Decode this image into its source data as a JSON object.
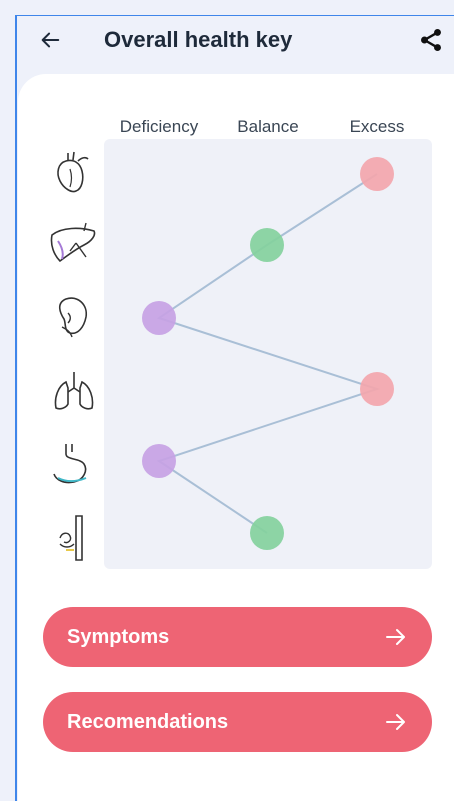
{
  "header": {
    "title": "Overall health key",
    "back_icon": "arrow-left-icon",
    "share_icon": "share-icon"
  },
  "chart_data": {
    "type": "scatter",
    "columns": [
      "Deficiency",
      "Balance",
      "Excess"
    ],
    "rows": [
      {
        "organ": "heart",
        "icon": "heart-icon",
        "level": "Excess",
        "color": "#f3a6ad"
      },
      {
        "organ": "liver",
        "icon": "liver-icon",
        "level": "Balance",
        "color": "#84d19d"
      },
      {
        "organ": "kidney",
        "icon": "kidney-icon",
        "level": "Deficiency",
        "color": "#c7a2e4"
      },
      {
        "organ": "lungs",
        "icon": "lungs-icon",
        "level": "Excess",
        "color": "#f3a6ad"
      },
      {
        "organ": "stomach",
        "icon": "stomach-icon",
        "level": "Deficiency",
        "color": "#c7a2e4"
      },
      {
        "organ": "intestine",
        "icon": "intestine-icon",
        "level": "Balance",
        "color": "#84d19d"
      }
    ],
    "line_color": "#a9bfd6"
  },
  "buttons": {
    "symptoms": "Symptoms",
    "recommendations": "Recomendations",
    "arrow_icon": "arrow-right-icon",
    "color": "#ee6474"
  }
}
